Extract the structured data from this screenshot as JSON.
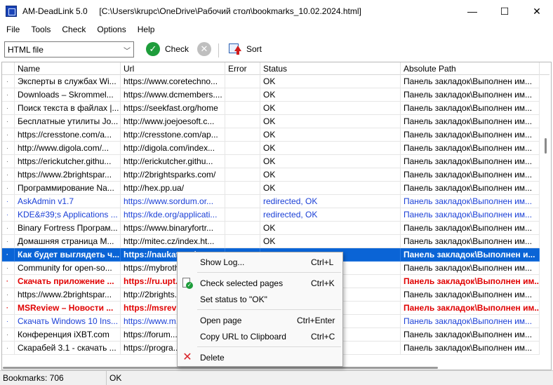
{
  "window": {
    "app_name": "AM-DeadLink 5.0",
    "file_path": "[C:\\Users\\krupc\\OneDrive\\Рабочий стол\\bookmarks_10.02.2024.html]",
    "minimize": "—",
    "maximize": "☐",
    "close": "✕"
  },
  "menu": [
    "File",
    "Tools",
    "Check",
    "Options",
    "Help"
  ],
  "toolbar": {
    "source_type": "HTML file",
    "check_label": "Check",
    "sort_label": "Sort"
  },
  "columns": [
    "Name",
    "Url",
    "Error",
    "Status",
    "Absolute Path"
  ],
  "rows": [
    {
      "name": "Эксперты в службах Wi...",
      "url": "https://www.coretechno...",
      "error": "",
      "status": "OK",
      "path": "Панель закладок\\Выполнен им...",
      "style": "normal"
    },
    {
      "name": "Downloads – Skrommel...",
      "url": "https://www.dcmembers....",
      "error": "",
      "status": "OK",
      "path": "Панель закладок\\Выполнен им...",
      "style": "normal"
    },
    {
      "name": "Поиск текста в файлах |...",
      "url": "https://seekfast.org/home",
      "error": "",
      "status": "OK",
      "path": "Панель закладок\\Выполнен им...",
      "style": "normal"
    },
    {
      "name": "Бесплатные утилиты Jo...",
      "url": "http://www.joejoesoft.c...",
      "error": "",
      "status": "OK",
      "path": "Панель закладок\\Выполнен им...",
      "style": "normal"
    },
    {
      "name": "https://cresstone.com/a...",
      "url": "http://cresstone.com/ap...",
      "error": "",
      "status": "OK",
      "path": "Панель закладок\\Выполнен им...",
      "style": "normal"
    },
    {
      "name": "http://www.digola.com/...",
      "url": "http://digola.com/index...",
      "error": "",
      "status": "OK",
      "path": "Панель закладок\\Выполнен им...",
      "style": "normal"
    },
    {
      "name": "https://erickutcher.githu...",
      "url": "http://erickutcher.githu...",
      "error": "",
      "status": "OK",
      "path": "Панель закладок\\Выполнен им...",
      "style": "normal"
    },
    {
      "name": "https://www.2brightspar...",
      "url": "http://2brightsparks.com/",
      "error": "",
      "status": "OK",
      "path": "Панель закладок\\Выполнен им...",
      "style": "normal"
    },
    {
      "name": "Программирование Na...",
      "url": "http://hex.pp.ua/",
      "error": "",
      "status": "OK",
      "path": "Панель закладок\\Выполнен им...",
      "style": "normal"
    },
    {
      "name": "AskAdmin v1.7",
      "url": "https://www.sordum.or...",
      "error": "",
      "status": "redirected, OK",
      "path": "Панель закладок\\Выполнен им...",
      "style": "blue"
    },
    {
      "name": "KDE&#39;s Applications ...",
      "url": "https://kde.org/applicati...",
      "error": "",
      "status": "redirected, OK",
      "path": "Панель закладок\\Выполнен им...",
      "style": "blue"
    },
    {
      "name": "Binary Fortress Програм...",
      "url": "https://www.binaryfortr...",
      "error": "",
      "status": "OK",
      "path": "Панель закладок\\Выполнен им...",
      "style": "normal"
    },
    {
      "name": "Домашняя страница M...",
      "url": "http://mitec.cz/index.ht...",
      "error": "",
      "status": "OK",
      "path": "Панель закладок\\Выполнен им...",
      "style": "normal"
    },
    {
      "name": "Как будет выглядеть ч...",
      "url": "https://naukatv.ru/..",
      "error": "",
      "status": "",
      "path": "Панель закладок\\Выполнен и...",
      "style": "sel"
    },
    {
      "name": "Community for open-so...",
      "url": "https://mybroth...",
      "error": "",
      "status": "",
      "path": "Панель закладок\\Выполнен им...",
      "style": "normal"
    },
    {
      "name": "Скачать приложение ...",
      "url": "https://ru.upt...",
      "error": "",
      "status": "",
      "path": "Панель закладок\\Выполнен им...",
      "style": "red"
    },
    {
      "name": "https://www.2brightspar...",
      "url": "http://2brights...",
      "error": "",
      "status": "",
      "path": "Панель закладок\\Выполнен им...",
      "style": "normal"
    },
    {
      "name": "MSReview – Новости ...",
      "url": "https://msrevi...",
      "error": "",
      "status": "",
      "path": "Панель закладок\\Выполнен им...",
      "style": "red"
    },
    {
      "name": "Скачать Windows 10 Ins...",
      "url": "https://www.m...",
      "error": "",
      "status": "",
      "path": "Панель закладок\\Выполнен им...",
      "style": "blue"
    },
    {
      "name": "Конференция iXBT.com",
      "url": "https://forum....",
      "error": "",
      "status": "",
      "path": "Панель закладок\\Выполнен им...",
      "style": "normal"
    },
    {
      "name": "Скарабей 3.1 - скачать ...",
      "url": "https://progra...",
      "error": "",
      "status": "",
      "path": "Панель закладок\\Выполнен им...",
      "style": "normal"
    }
  ],
  "status_bar": {
    "bookmarks": "Bookmarks: 706",
    "state": "OK"
  },
  "context_menu": {
    "items": [
      {
        "label": "Show Log...",
        "shortcut": "Ctrl+L",
        "icon": ""
      },
      {
        "label": "Check selected pages",
        "shortcut": "Ctrl+K",
        "icon": "check-doc-icon"
      },
      {
        "label": "Set status to \"OK\"",
        "shortcut": "",
        "icon": ""
      },
      {
        "label": "Open page",
        "shortcut": "Ctrl+Enter",
        "icon": ""
      },
      {
        "label": "Copy URL to Clipboard",
        "shortcut": "Ctrl+C",
        "icon": ""
      },
      {
        "label": "Delete",
        "shortcut": "",
        "icon": "delete-icon"
      }
    ]
  }
}
